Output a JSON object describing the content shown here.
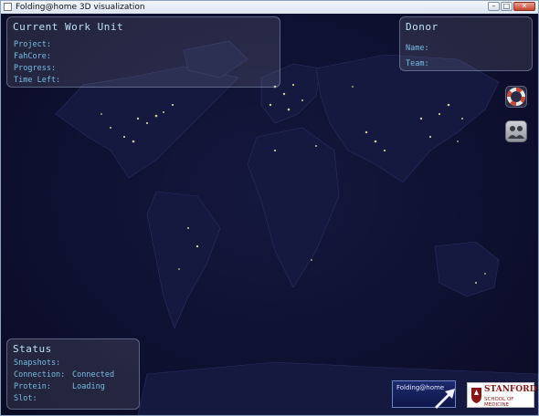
{
  "window": {
    "title": "Folding@home 3D visualization"
  },
  "work_unit": {
    "title": "Current Work Unit",
    "labels": [
      "Project:",
      "FahCore:",
      "Progress:",
      "Time Left:"
    ]
  },
  "donor": {
    "title": "Donor",
    "labels": [
      "Name:",
      "Team:"
    ]
  },
  "status": {
    "title": "Status",
    "rows": [
      {
        "label": "Snapshots:",
        "value": ""
      },
      {
        "label": "Connection:",
        "value": "Connected"
      },
      {
        "label": "Protein:",
        "value": "Loading"
      },
      {
        "label": "Slot:",
        "value": ""
      }
    ]
  },
  "icons": {
    "help": "lifebuoy-icon",
    "people": "people-icon",
    "fah_arrow": "arrow-icon"
  },
  "logos": {
    "folding": "Folding@home",
    "stanford_title": "STANFORD",
    "stanford_sub": "SCHOOL OF MEDICINE"
  },
  "colors": {
    "panel_text": "#79bde0",
    "title_text": "#bfe0f5",
    "stanford_red": "#8c1515"
  }
}
